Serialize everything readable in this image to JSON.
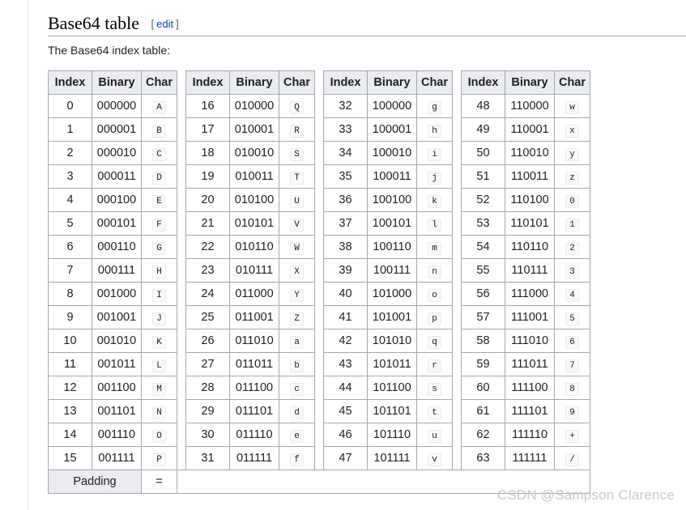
{
  "section": {
    "title": "Base64 table",
    "edit_open": "[",
    "edit_label": "edit",
    "edit_close": "]",
    "intro": "The Base64 index table:"
  },
  "table": {
    "headers": {
      "index": "Index",
      "binary": "Binary",
      "char": "Char"
    },
    "rows": [
      [
        "0",
        "000000",
        "A",
        "16",
        "010000",
        "Q",
        "32",
        "100000",
        "g",
        "48",
        "110000",
        "w"
      ],
      [
        "1",
        "000001",
        "B",
        "17",
        "010001",
        "R",
        "33",
        "100001",
        "h",
        "49",
        "110001",
        "x"
      ],
      [
        "2",
        "000010",
        "C",
        "18",
        "010010",
        "S",
        "34",
        "100010",
        "i",
        "50",
        "110010",
        "y"
      ],
      [
        "3",
        "000011",
        "D",
        "19",
        "010011",
        "T",
        "35",
        "100011",
        "j",
        "51",
        "110011",
        "z"
      ],
      [
        "4",
        "000100",
        "E",
        "20",
        "010100",
        "U",
        "36",
        "100100",
        "k",
        "52",
        "110100",
        "0"
      ],
      [
        "5",
        "000101",
        "F",
        "21",
        "010101",
        "V",
        "37",
        "100101",
        "l",
        "53",
        "110101",
        "1"
      ],
      [
        "6",
        "000110",
        "G",
        "22",
        "010110",
        "W",
        "38",
        "100110",
        "m",
        "54",
        "110110",
        "2"
      ],
      [
        "7",
        "000111",
        "H",
        "23",
        "010111",
        "X",
        "39",
        "100111",
        "n",
        "55",
        "110111",
        "3"
      ],
      [
        "8",
        "001000",
        "I",
        "24",
        "011000",
        "Y",
        "40",
        "101000",
        "o",
        "56",
        "111000",
        "4"
      ],
      [
        "9",
        "001001",
        "J",
        "25",
        "011001",
        "Z",
        "41",
        "101001",
        "p",
        "57",
        "111001",
        "5"
      ],
      [
        "10",
        "001010",
        "K",
        "26",
        "011010",
        "a",
        "42",
        "101010",
        "q",
        "58",
        "111010",
        "6"
      ],
      [
        "11",
        "001011",
        "L",
        "27",
        "011011",
        "b",
        "43",
        "101011",
        "r",
        "59",
        "111011",
        "7"
      ],
      [
        "12",
        "001100",
        "M",
        "28",
        "011100",
        "c",
        "44",
        "101100",
        "s",
        "60",
        "111100",
        "8"
      ],
      [
        "13",
        "001101",
        "N",
        "29",
        "011101",
        "d",
        "45",
        "101101",
        "t",
        "61",
        "111101",
        "9"
      ],
      [
        "14",
        "001110",
        "O",
        "30",
        "011110",
        "e",
        "46",
        "101110",
        "u",
        "62",
        "111110",
        "+"
      ],
      [
        "15",
        "001111",
        "P",
        "31",
        "011111",
        "f",
        "47",
        "101111",
        "v",
        "63",
        "111111",
        "/"
      ]
    ],
    "padding_label": "Padding",
    "padding_char": "="
  },
  "watermark": "CSDN @Sampson Clarence"
}
